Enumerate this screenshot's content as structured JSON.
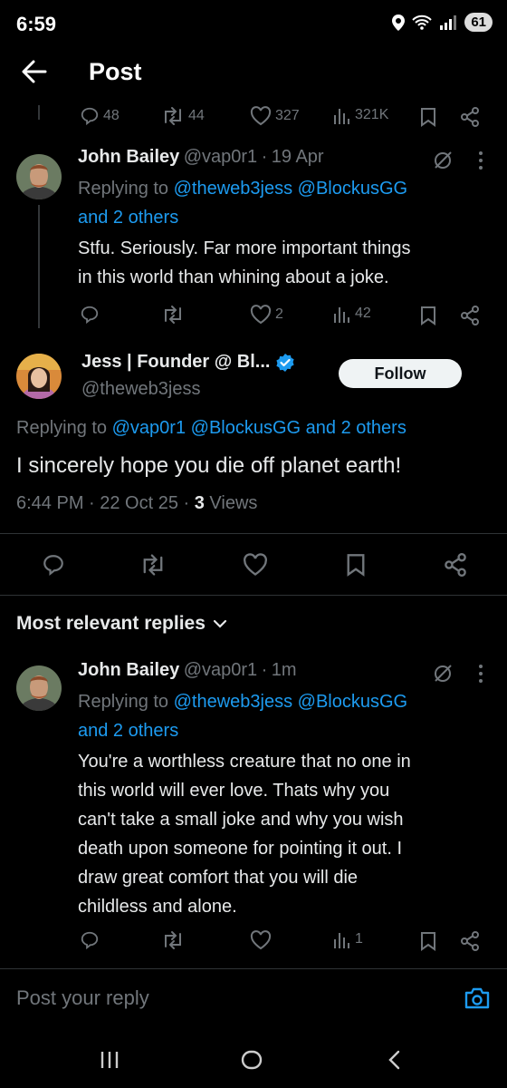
{
  "status_bar": {
    "time": "6:59",
    "battery": "61"
  },
  "header": {
    "title": "Post"
  },
  "parent_actions": {
    "replies": "48",
    "reposts": "44",
    "likes": "327",
    "views": "321K"
  },
  "reply1": {
    "name": "John Bailey",
    "handle": "@vap0r1",
    "dot": "·",
    "time": "19 Apr",
    "replying_prefix": "Replying to",
    "replying_users": "@theweb3jess @BlockusGG",
    "replying_others": "and 2 others",
    "text_line1": "Stfu. Seriously. Far more important things",
    "text_line2": "in this world than whining about a joke.",
    "likes": "2",
    "views": "42"
  },
  "main_post": {
    "name": "Jess | Founder @ Bl...",
    "handle": "@theweb3jess",
    "follow_label": "Follow",
    "replying_prefix": "Replying to",
    "replying_users": "@vap0r1 @BlockusGG and 2 others",
    "text": "I sincerely hope you die off planet earth!",
    "time": "6:44 PM · 22 Oct 25 · ",
    "views_count": "3",
    "views_label": " Views"
  },
  "replies_section": {
    "label": "Most relevant replies"
  },
  "reply2": {
    "name": "John Bailey",
    "handle": "@vap0r1",
    "dot": "·",
    "time": "1m",
    "replying_prefix": "Replying to",
    "replying_users": "@theweb3jess @BlockusGG",
    "replying_others": "and 2 others",
    "text_line1": "You're a worthless creature that no one in",
    "text_line2": "this world will ever love. Thats why you",
    "text_line3": "can't take a small joke and why you wish",
    "text_line4": "death upon someone for pointing it out. I",
    "text_line5": "draw great comfort that you will die",
    "text_line6": "childless and alone.",
    "views": "1"
  },
  "reply_bar": {
    "placeholder": "Post your reply"
  },
  "colors": {
    "accent": "#1d9bf0",
    "muted": "#71767b",
    "text": "#e7e9ea",
    "background": "#000000",
    "verified": "#1d9bf0"
  }
}
